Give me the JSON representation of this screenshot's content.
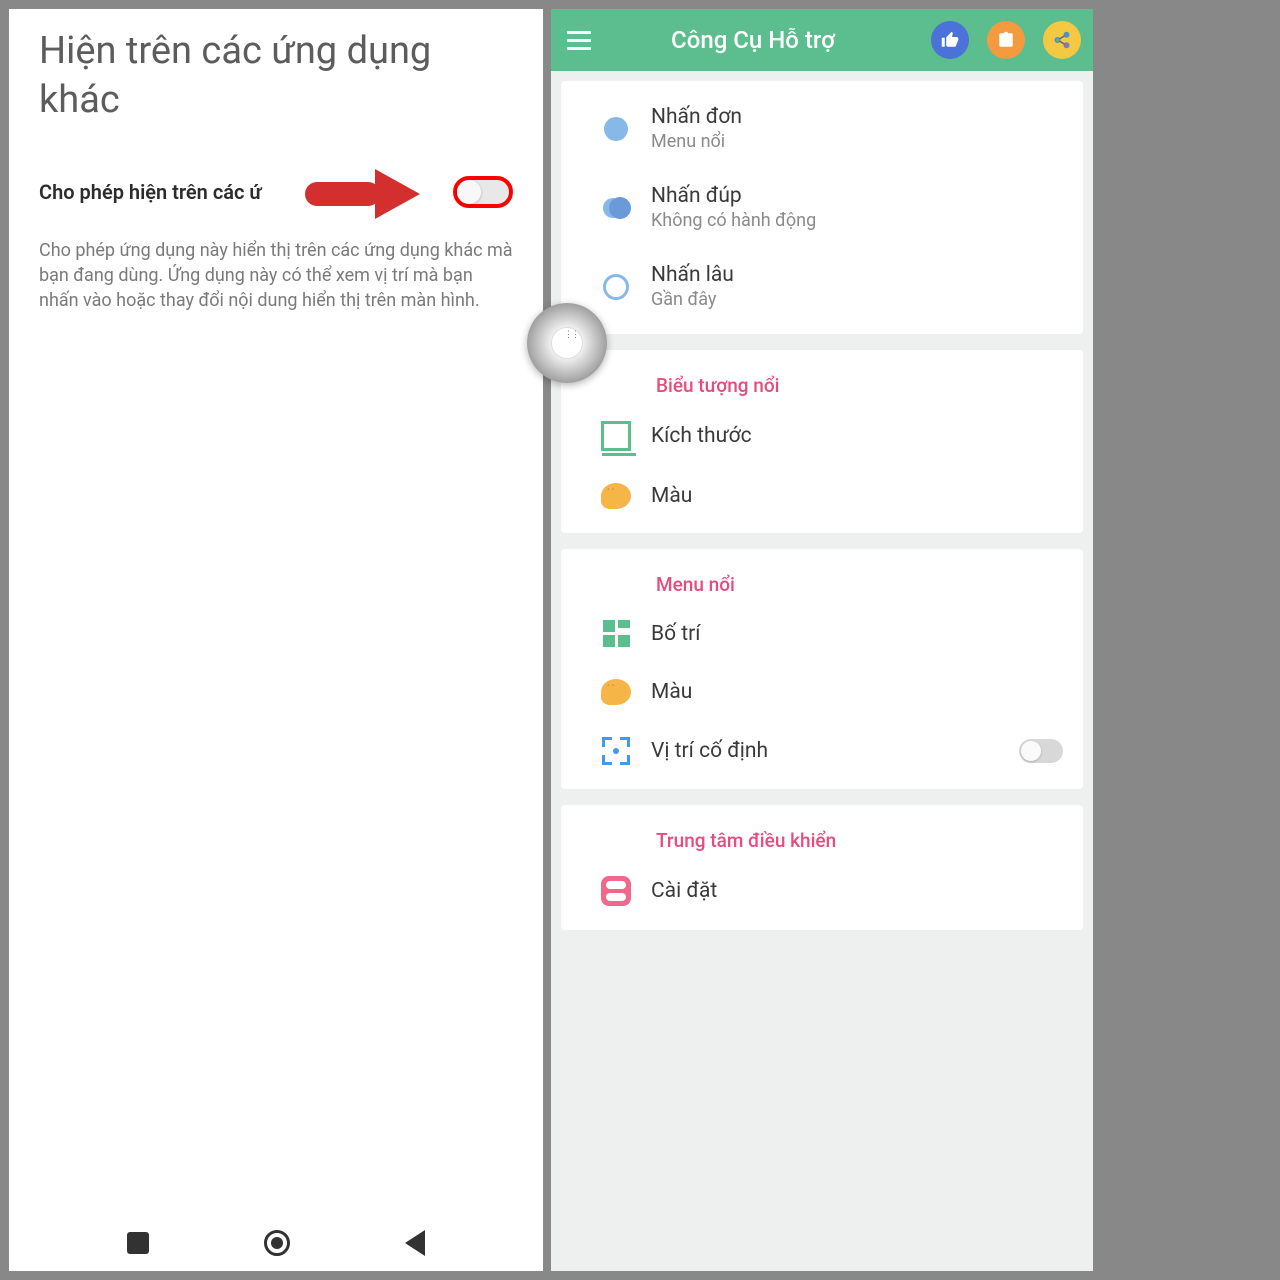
{
  "left": {
    "title": "Hiện trên các ứng dụng khác",
    "toggle_label": "Cho phép hiện trên các ứ",
    "description": "Cho phép ứng dụng này hiển thị trên các ứng dụng khác mà bạn đang dùng. Ứng dụng này có thể xem vị trí mà bạn nhấn vào hoặc thay đổi nội dung hiển thị trên màn hình."
  },
  "right": {
    "header_title": "Công Cụ Hỗ trợ",
    "actions": {
      "single_tap": {
        "title": "Nhấn đơn",
        "sub": "Menu nổi"
      },
      "double_tap": {
        "title": "Nhấn đúp",
        "sub": "Không có hành động"
      },
      "long_press": {
        "title": "Nhấn lâu",
        "sub": "Gần đây"
      }
    },
    "section_icon": "Biểu tượng nổi",
    "size": "Kích thước",
    "color": "Màu",
    "section_menu": "Menu nổi",
    "layout": "Bố trí",
    "color2": "Màu",
    "fixed_pos": "Vị trí cố định",
    "section_control": "Trung tâm điều khiển",
    "settings": "Cài đặt"
  }
}
